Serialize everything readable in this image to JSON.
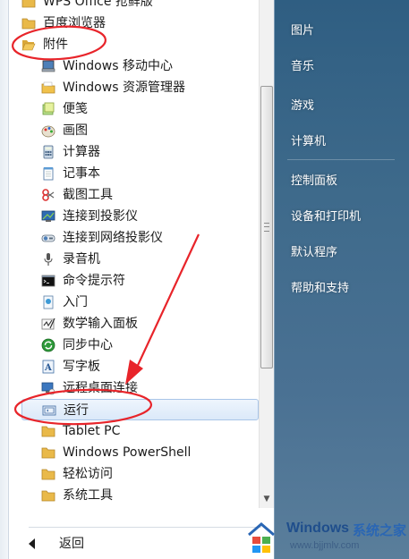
{
  "start_menu": {
    "programs": [
      {
        "label": "WPS Office 抢鲜版",
        "icon": "folder-icon",
        "level": "root"
      },
      {
        "label": "百度浏览器",
        "icon": "folder-icon",
        "level": "root"
      },
      {
        "label": "附件",
        "icon": "folder-open-icon",
        "level": "root"
      },
      {
        "label": "Windows 移动中心",
        "icon": "mobility-center-icon",
        "level": "child"
      },
      {
        "label": "Windows 资源管理器",
        "icon": "explorer-icon",
        "level": "child"
      },
      {
        "label": "便笺",
        "icon": "sticky-notes-icon",
        "level": "child"
      },
      {
        "label": "画图",
        "icon": "paint-icon",
        "level": "child"
      },
      {
        "label": "计算器",
        "icon": "calculator-icon",
        "level": "child"
      },
      {
        "label": "记事本",
        "icon": "notepad-icon",
        "level": "child"
      },
      {
        "label": "截图工具",
        "icon": "snipping-tool-icon",
        "level": "child"
      },
      {
        "label": "连接到投影仪",
        "icon": "projector-icon",
        "level": "child"
      },
      {
        "label": "连接到网络投影仪",
        "icon": "network-projector-icon",
        "level": "child"
      },
      {
        "label": "录音机",
        "icon": "microphone-icon",
        "level": "child"
      },
      {
        "label": "命令提示符",
        "icon": "command-prompt-icon",
        "level": "child"
      },
      {
        "label": "入门",
        "icon": "getting-started-icon",
        "level": "child"
      },
      {
        "label": "数学输入面板",
        "icon": "math-input-icon",
        "level": "child"
      },
      {
        "label": "同步中心",
        "icon": "sync-center-icon",
        "level": "child"
      },
      {
        "label": "写字板",
        "icon": "wordpad-icon",
        "level": "child"
      },
      {
        "label": "远程桌面连接",
        "icon": "remote-desktop-icon",
        "level": "child"
      },
      {
        "label": "运行",
        "icon": "run-icon",
        "level": "child",
        "selected": true
      },
      {
        "label": "Tablet PC",
        "icon": "folder-icon",
        "level": "child"
      },
      {
        "label": "Windows PowerShell",
        "icon": "folder-icon",
        "level": "child"
      },
      {
        "label": "轻松访问",
        "icon": "folder-icon",
        "level": "child"
      },
      {
        "label": "系统工具",
        "icon": "folder-icon",
        "level": "child"
      }
    ],
    "back_label": "返回",
    "right_items": [
      "图片",
      "音乐",
      "游戏",
      "计算机",
      "控制面板",
      "设备和打印机",
      "默认程序",
      "帮助和支持"
    ]
  },
  "watermark": {
    "brand": "Windows",
    "brand_cn": "系统之家",
    "url": "www.bjjmlv.com"
  },
  "colors": {
    "annotation_red": "#e8242a",
    "selection_border": "#a9c5e8",
    "right_pane": "#3e6a8b"
  }
}
